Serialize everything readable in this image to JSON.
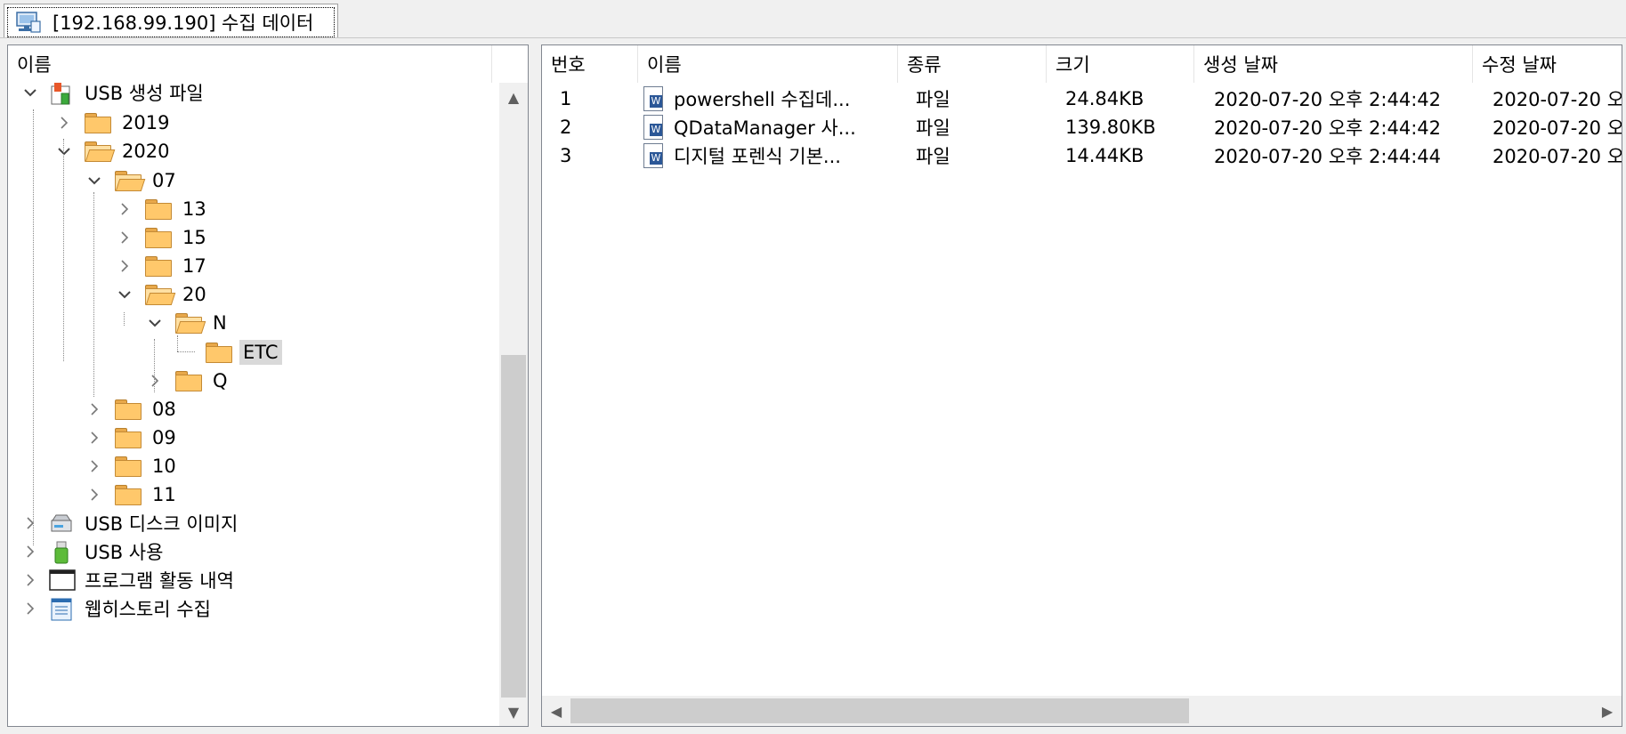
{
  "tab": {
    "title": "[192.168.99.190] 수집 데이터",
    "icon": "network-computer-icon"
  },
  "tree": {
    "header": "이름",
    "items": [
      {
        "label": "USB 생성 파일",
        "icon": "usb-file-icon",
        "expanded": true
      },
      {
        "label": "2019",
        "icon": "folder-icon",
        "expanded": false
      },
      {
        "label": "2020",
        "icon": "folder-open-icon",
        "expanded": true
      },
      {
        "label": "07",
        "icon": "folder-open-icon",
        "expanded": true
      },
      {
        "label": "13",
        "icon": "folder-icon",
        "expanded": false
      },
      {
        "label": "15",
        "icon": "folder-icon",
        "expanded": false
      },
      {
        "label": "17",
        "icon": "folder-icon",
        "expanded": false
      },
      {
        "label": "20",
        "icon": "folder-open-icon",
        "expanded": true
      },
      {
        "label": "N",
        "icon": "folder-open-icon",
        "expanded": true
      },
      {
        "label": "ETC",
        "icon": "folder-icon",
        "selected": true
      },
      {
        "label": "Q",
        "icon": "folder-icon",
        "expanded": false
      },
      {
        "label": "08",
        "icon": "folder-icon",
        "expanded": false
      },
      {
        "label": "09",
        "icon": "folder-icon",
        "expanded": false
      },
      {
        "label": "10",
        "icon": "folder-icon",
        "expanded": false
      },
      {
        "label": "11",
        "icon": "folder-icon",
        "expanded": false
      },
      {
        "label": "USB 디스크 이미지",
        "icon": "disk-drive-icon",
        "expanded": false
      },
      {
        "label": "USB 사용",
        "icon": "usb-stick-icon",
        "expanded": false
      },
      {
        "label": "프로그램 활동 내역",
        "icon": "program-window-icon",
        "expanded": false
      },
      {
        "label": "웹히스토리 수집",
        "icon": "web-history-icon",
        "expanded": false
      }
    ]
  },
  "list": {
    "columns": [
      "번호",
      "이름",
      "종류",
      "크기",
      "생성 날짜",
      "수정 날짜"
    ],
    "rows": [
      {
        "no": "1",
        "name": "powershell 수집데...",
        "type": "파일",
        "size": "24.84KB",
        "created": "2020-07-20 오후 2:44:42",
        "modified": "2020-07-20 오"
      },
      {
        "no": "2",
        "name": "QDataManager 사...",
        "type": "파일",
        "size": "139.80KB",
        "created": "2020-07-20 오후 2:44:42",
        "modified": "2020-07-20 오"
      },
      {
        "no": "3",
        "name": "디지털 포렌식 기본...",
        "type": "파일",
        "size": "14.44KB",
        "created": "2020-07-20 오후 2:44:44",
        "modified": "2020-07-20 오"
      }
    ]
  },
  "scroll": {
    "tree_position": 1.0,
    "list_position": 0.0
  },
  "colors": {
    "selection": "#d9d9d9",
    "folder": "#ffc86b",
    "border": "#828790"
  }
}
